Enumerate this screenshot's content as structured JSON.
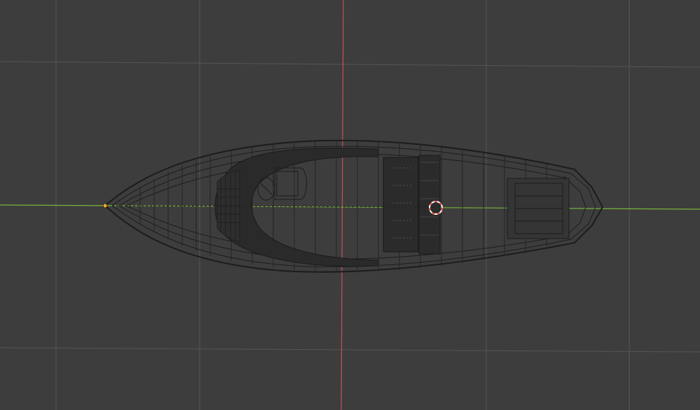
{
  "viewport": {
    "view": "top-orthographic",
    "shading": "wireframe",
    "background_color": "#3d3d3d",
    "grid_color": "#565656",
    "x_axis_color": "#c55158",
    "y_axis_color": "#78b43c"
  },
  "scene_object": {
    "name": "boat",
    "wire_color": "#1c1c1c",
    "origin_color": "#f0a830"
  },
  "cursor_3d": {
    "name": "3d-cursor",
    "ring_color_primary": "#e85040",
    "ring_color_secondary": "#ffffff"
  }
}
